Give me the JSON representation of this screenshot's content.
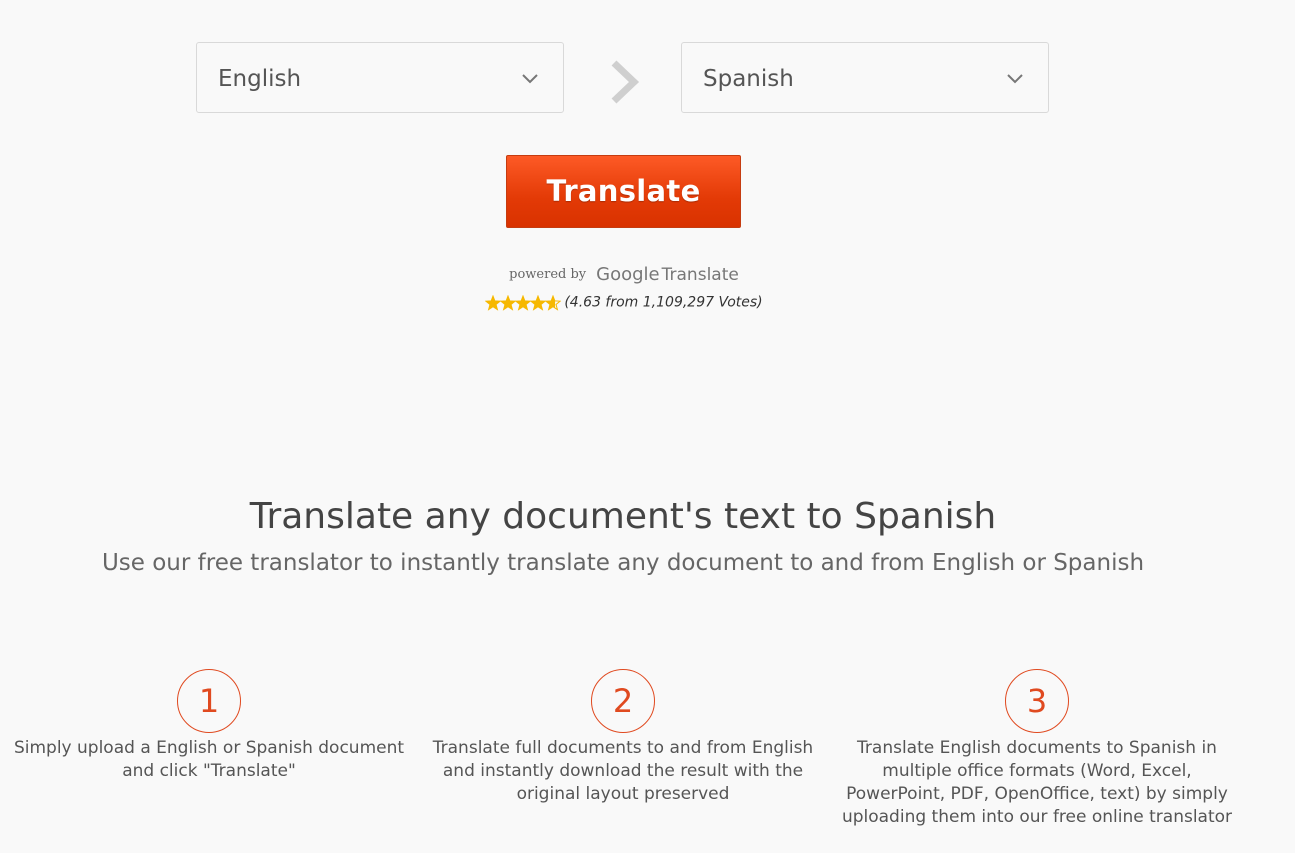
{
  "selectors": {
    "source_language": "English",
    "target_language": "Spanish"
  },
  "translate_button": {
    "label": "Translate"
  },
  "powered_by": {
    "prefix": "powered by",
    "brand": "Google",
    "product": "Translate"
  },
  "rating": {
    "stars_value": 4.63,
    "stars_max": 5,
    "text": "(4.63 from 1,109,297 Votes)"
  },
  "hero": {
    "title": "Translate any document's text to Spanish",
    "subtitle": "Use our free translator to instantly translate any document to and from English or Spanish"
  },
  "steps": [
    {
      "number": "1",
      "lines": [
        "Simply upload a English or Spanish document",
        "and click \"Translate\""
      ]
    },
    {
      "number": "2",
      "lines": [
        "Translate full documents to and from English",
        "and instantly download the result with the",
        "original layout preserved"
      ]
    },
    {
      "number": "3",
      "lines": [
        "Translate English documents to Spanish in",
        "multiple office formats (Word, Excel,",
        "PowerPoint, PDF, OpenOffice, text) by simply",
        "uploading them into our free online translator"
      ]
    }
  ],
  "colors": {
    "accent": "#e04a20",
    "button_top": "#fd5a26",
    "button_bottom": "#d93200",
    "star": "#f6b800",
    "background": "#f9f9f9"
  },
  "icons": {
    "dropdown": "chevron-down-icon",
    "direction": "chevron-right-icon",
    "rating": "star-icon"
  }
}
